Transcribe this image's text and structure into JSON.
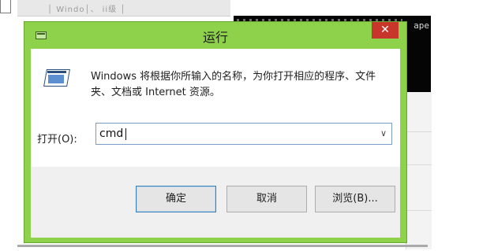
{
  "background": {
    "top_blur_text": "│ Windo│、 ii级 │",
    "terminal_text": "ape"
  },
  "dialog": {
    "title": "运行",
    "close_glyph": "✕",
    "description": "Windows 将根据你所输入的名称，为你打开相应的程序、文件夹、文档或 Internet 资源。",
    "open_label": "打开(O):",
    "input_value": "cmd",
    "dropdown_glyph": "∨",
    "buttons": {
      "ok": "确定",
      "cancel": "取消",
      "browse": "浏览(B)..."
    }
  },
  "colors": {
    "title_bar": "#8ed14a",
    "close_button": "#c7352b",
    "input_border": "#7a9cc7"
  },
  "icons": [
    "run-window-icon",
    "run-program-icon",
    "close-icon",
    "chevron-down-icon"
  ]
}
